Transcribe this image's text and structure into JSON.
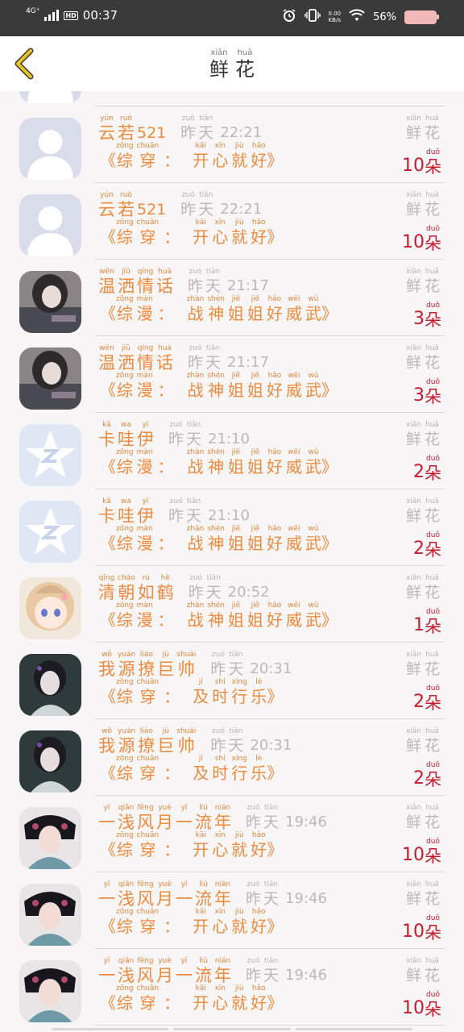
{
  "status_bar": {
    "network": "4G⁺",
    "hd": "HD",
    "time": "00:37",
    "speed_top": "0.00",
    "speed_unit": "KB/s",
    "battery": "56%"
  },
  "header": {
    "title": [
      {
        "py": "xiān",
        "hz": "鲜"
      },
      {
        "py": "huā",
        "hz": "花"
      }
    ]
  },
  "labels": {
    "flower": [
      {
        "py": "xiān",
        "hz": "鲜"
      },
      {
        "py": "huā",
        "hz": "花"
      }
    ],
    "unit": {
      "py": "duǒ",
      "hz": "朵"
    },
    "quote_open": "《",
    "quote_close": "》",
    "colon": "："
  },
  "items": [
    {
      "avatar": "default-person",
      "name": [
        {
          "py": "yún",
          "hz": "云"
        },
        {
          "py": "ruò",
          "hz": "若"
        },
        {
          "py": "",
          "hz": "521"
        }
      ],
      "time_word": [
        {
          "py": "zuó",
          "hz": "昨"
        },
        {
          "py": "tiān",
          "hz": "天"
        }
      ],
      "clock": "22:21",
      "category": [
        {
          "py": "zōng",
          "hz": "综"
        },
        {
          "py": "chuān",
          "hz": "穿"
        }
      ],
      "book": [
        {
          "py": "kāi",
          "hz": "开"
        },
        {
          "py": "xīn",
          "hz": "心"
        },
        {
          "py": "jiù",
          "hz": "就"
        },
        {
          "py": "hǎo",
          "hz": "好"
        }
      ],
      "count": "10"
    },
    {
      "avatar": "default-person",
      "name": [
        {
          "py": "yún",
          "hz": "云"
        },
        {
          "py": "ruò",
          "hz": "若"
        },
        {
          "py": "",
          "hz": "521"
        }
      ],
      "time_word": [
        {
          "py": "zuó",
          "hz": "昨"
        },
        {
          "py": "tiān",
          "hz": "天"
        }
      ],
      "clock": "22:21",
      "category": [
        {
          "py": "zōng",
          "hz": "综"
        },
        {
          "py": "chuān",
          "hz": "穿"
        }
      ],
      "book": [
        {
          "py": "kāi",
          "hz": "开"
        },
        {
          "py": "xīn",
          "hz": "心"
        },
        {
          "py": "jiù",
          "hz": "就"
        },
        {
          "py": "hǎo",
          "hz": "好"
        }
      ],
      "count": "10"
    },
    {
      "avatar": "girl-gray",
      "name": [
        {
          "py": "wēn",
          "hz": "温"
        },
        {
          "py": "jiǔ",
          "hz": "洒"
        },
        {
          "py": "qíng",
          "hz": "情"
        },
        {
          "py": "huà",
          "hz": "话"
        }
      ],
      "time_word": [
        {
          "py": "zuó",
          "hz": "昨"
        },
        {
          "py": "tiān",
          "hz": "天"
        }
      ],
      "clock": "21:17",
      "category": [
        {
          "py": "zōng",
          "hz": "综"
        },
        {
          "py": "màn",
          "hz": "漫"
        }
      ],
      "book": [
        {
          "py": "zhàn",
          "hz": "战"
        },
        {
          "py": "shén",
          "hz": "神"
        },
        {
          "py": "jiě",
          "hz": "姐"
        },
        {
          "py": "jiě",
          "hz": "姐"
        },
        {
          "py": "hǎo",
          "hz": "好"
        },
        {
          "py": "wēi",
          "hz": "威"
        },
        {
          "py": "wǔ",
          "hz": "武"
        }
      ],
      "count": "3"
    },
    {
      "avatar": "girl-gray",
      "name": [
        {
          "py": "wēn",
          "hz": "温"
        },
        {
          "py": "jiǔ",
          "hz": "洒"
        },
        {
          "py": "qíng",
          "hz": "情"
        },
        {
          "py": "huà",
          "hz": "话"
        }
      ],
      "time_word": [
        {
          "py": "zuó",
          "hz": "昨"
        },
        {
          "py": "tiān",
          "hz": "天"
        }
      ],
      "clock": "21:17",
      "category": [
        {
          "py": "zōng",
          "hz": "综"
        },
        {
          "py": "màn",
          "hz": "漫"
        }
      ],
      "book": [
        {
          "py": "zhàn",
          "hz": "战"
        },
        {
          "py": "shén",
          "hz": "神"
        },
        {
          "py": "jiě",
          "hz": "姐"
        },
        {
          "py": "jiě",
          "hz": "姐"
        },
        {
          "py": "hǎo",
          "hz": "好"
        },
        {
          "py": "wēi",
          "hz": "威"
        },
        {
          "py": "wǔ",
          "hz": "武"
        }
      ],
      "count": "3"
    },
    {
      "avatar": "qq-star",
      "name": [
        {
          "py": "kǎ",
          "hz": "卡"
        },
        {
          "py": "wa",
          "hz": "哇"
        },
        {
          "py": "yī",
          "hz": "伊"
        }
      ],
      "time_word": [
        {
          "py": "zuó",
          "hz": "昨"
        },
        {
          "py": "tiān",
          "hz": "天"
        }
      ],
      "clock": "21:10",
      "category": [
        {
          "py": "zōng",
          "hz": "综"
        },
        {
          "py": "màn",
          "hz": "漫"
        }
      ],
      "book": [
        {
          "py": "zhàn",
          "hz": "战"
        },
        {
          "py": "shén",
          "hz": "神"
        },
        {
          "py": "jiě",
          "hz": "姐"
        },
        {
          "py": "jiě",
          "hz": "姐"
        },
        {
          "py": "hǎo",
          "hz": "好"
        },
        {
          "py": "wēi",
          "hz": "威"
        },
        {
          "py": "wǔ",
          "hz": "武"
        }
      ],
      "count": "2"
    },
    {
      "avatar": "qq-star",
      "name": [
        {
          "py": "kǎ",
          "hz": "卡"
        },
        {
          "py": "wa",
          "hz": "哇"
        },
        {
          "py": "yī",
          "hz": "伊"
        }
      ],
      "time_word": [
        {
          "py": "zuó",
          "hz": "昨"
        },
        {
          "py": "tiān",
          "hz": "天"
        }
      ],
      "clock": "21:10",
      "category": [
        {
          "py": "zōng",
          "hz": "综"
        },
        {
          "py": "màn",
          "hz": "漫"
        }
      ],
      "book": [
        {
          "py": "zhàn",
          "hz": "战"
        },
        {
          "py": "shén",
          "hz": "神"
        },
        {
          "py": "jiě",
          "hz": "姐"
        },
        {
          "py": "jiě",
          "hz": "姐"
        },
        {
          "py": "hǎo",
          "hz": "好"
        },
        {
          "py": "wēi",
          "hz": "威"
        },
        {
          "py": "wǔ",
          "hz": "武"
        }
      ],
      "count": "2"
    },
    {
      "avatar": "anime-girl",
      "name": [
        {
          "py": "qīng",
          "hz": "清"
        },
        {
          "py": "cháo",
          "hz": "朝"
        },
        {
          "py": "rú",
          "hz": "如"
        },
        {
          "py": "hè",
          "hz": "鹤"
        }
      ],
      "time_word": [
        {
          "py": "zuó",
          "hz": "昨"
        },
        {
          "py": "tiān",
          "hz": "天"
        }
      ],
      "clock": "20:52",
      "category": [
        {
          "py": "zōng",
          "hz": "综"
        },
        {
          "py": "màn",
          "hz": "漫"
        }
      ],
      "book": [
        {
          "py": "zhàn",
          "hz": "战"
        },
        {
          "py": "shén",
          "hz": "神"
        },
        {
          "py": "jiě",
          "hz": "姐"
        },
        {
          "py": "jiě",
          "hz": "姐"
        },
        {
          "py": "hǎo",
          "hz": "好"
        },
        {
          "py": "wēi",
          "hz": "威"
        },
        {
          "py": "wǔ",
          "hz": "武"
        }
      ],
      "count": "1"
    },
    {
      "avatar": "actress-dark",
      "name": [
        {
          "py": "wǒ",
          "hz": "我"
        },
        {
          "py": "yuán",
          "hz": "源"
        },
        {
          "py": "liáo",
          "hz": "撩"
        },
        {
          "py": "jù",
          "hz": "巨"
        },
        {
          "py": "shuài",
          "hz": "帅"
        }
      ],
      "time_word": [
        {
          "py": "zuó",
          "hz": "昨"
        },
        {
          "py": "tiān",
          "hz": "天"
        }
      ],
      "clock": "20:31",
      "category": [
        {
          "py": "zōng",
          "hz": "综"
        },
        {
          "py": "chuān",
          "hz": "穿"
        }
      ],
      "book": [
        {
          "py": "jí",
          "hz": "及"
        },
        {
          "py": "shí",
          "hz": "时"
        },
        {
          "py": "xíng",
          "hz": "行"
        },
        {
          "py": "lè",
          "hz": "乐"
        }
      ],
      "count": "2"
    },
    {
      "avatar": "actress-dark",
      "name": [
        {
          "py": "wǒ",
          "hz": "我"
        },
        {
          "py": "yuán",
          "hz": "源"
        },
        {
          "py": "liáo",
          "hz": "撩"
        },
        {
          "py": "jù",
          "hz": "巨"
        },
        {
          "py": "shuài",
          "hz": "帅"
        }
      ],
      "time_word": [
        {
          "py": "zuó",
          "hz": "昨"
        },
        {
          "py": "tiān",
          "hz": "天"
        }
      ],
      "clock": "20:31",
      "category": [
        {
          "py": "zōng",
          "hz": "综"
        },
        {
          "py": "chuān",
          "hz": "穿"
        }
      ],
      "book": [
        {
          "py": "jí",
          "hz": "及"
        },
        {
          "py": "shí",
          "hz": "时"
        },
        {
          "py": "xíng",
          "hz": "行"
        },
        {
          "py": "lè",
          "hz": "乐"
        }
      ],
      "count": "2"
    },
    {
      "avatar": "opera-girl",
      "name": [
        {
          "py": "yī",
          "hz": "一"
        },
        {
          "py": "qiǎn",
          "hz": "浅"
        },
        {
          "py": "fēng",
          "hz": "风"
        },
        {
          "py": "yuè",
          "hz": "月"
        },
        {
          "py": "yī",
          "hz": "一"
        },
        {
          "py": "liú",
          "hz": "流"
        },
        {
          "py": "nián",
          "hz": "年"
        }
      ],
      "time_word": [
        {
          "py": "zuó",
          "hz": "昨"
        },
        {
          "py": "tiān",
          "hz": "天"
        }
      ],
      "clock": "19:46",
      "category": [
        {
          "py": "zōng",
          "hz": "综"
        },
        {
          "py": "chuān",
          "hz": "穿"
        }
      ],
      "book": [
        {
          "py": "kāi",
          "hz": "开"
        },
        {
          "py": "xīn",
          "hz": "心"
        },
        {
          "py": "jiù",
          "hz": "就"
        },
        {
          "py": "hǎo",
          "hz": "好"
        }
      ],
      "count": "10"
    },
    {
      "avatar": "opera-girl",
      "name": [
        {
          "py": "yī",
          "hz": "一"
        },
        {
          "py": "qiǎn",
          "hz": "浅"
        },
        {
          "py": "fēng",
          "hz": "风"
        },
        {
          "py": "yuè",
          "hz": "月"
        },
        {
          "py": "yī",
          "hz": "一"
        },
        {
          "py": "liú",
          "hz": "流"
        },
        {
          "py": "nián",
          "hz": "年"
        }
      ],
      "time_word": [
        {
          "py": "zuó",
          "hz": "昨"
        },
        {
          "py": "tiān",
          "hz": "天"
        }
      ],
      "clock": "19:46",
      "category": [
        {
          "py": "zōng",
          "hz": "综"
        },
        {
          "py": "chuān",
          "hz": "穿"
        }
      ],
      "book": [
        {
          "py": "kāi",
          "hz": "开"
        },
        {
          "py": "xīn",
          "hz": "心"
        },
        {
          "py": "jiù",
          "hz": "就"
        },
        {
          "py": "hǎo",
          "hz": "好"
        }
      ],
      "count": "10"
    },
    {
      "avatar": "opera-girl",
      "name": [
        {
          "py": "yī",
          "hz": "一"
        },
        {
          "py": "qiǎn",
          "hz": "浅"
        },
        {
          "py": "fēng",
          "hz": "风"
        },
        {
          "py": "yuè",
          "hz": "月"
        },
        {
          "py": "yī",
          "hz": "一"
        },
        {
          "py": "liú",
          "hz": "流"
        },
        {
          "py": "nián",
          "hz": "年"
        }
      ],
      "time_word": [
        {
          "py": "zuó",
          "hz": "昨"
        },
        {
          "py": "tiān",
          "hz": "天"
        }
      ],
      "clock": "19:46",
      "category": [
        {
          "py": "zōng",
          "hz": "综"
        },
        {
          "py": "chuān",
          "hz": "穿"
        }
      ],
      "book": [
        {
          "py": "kāi",
          "hz": "开"
        },
        {
          "py": "xīn",
          "hz": "心"
        },
        {
          "py": "jiù",
          "hz": "就"
        },
        {
          "py": "hǎo",
          "hz": "好"
        }
      ],
      "count": "10"
    }
  ],
  "colors": {
    "accent_orange": "#ee8a3c",
    "count_red": "#c51b2d",
    "muted_gray": "#b9b9b9",
    "back_arrow": "#e8c322"
  }
}
